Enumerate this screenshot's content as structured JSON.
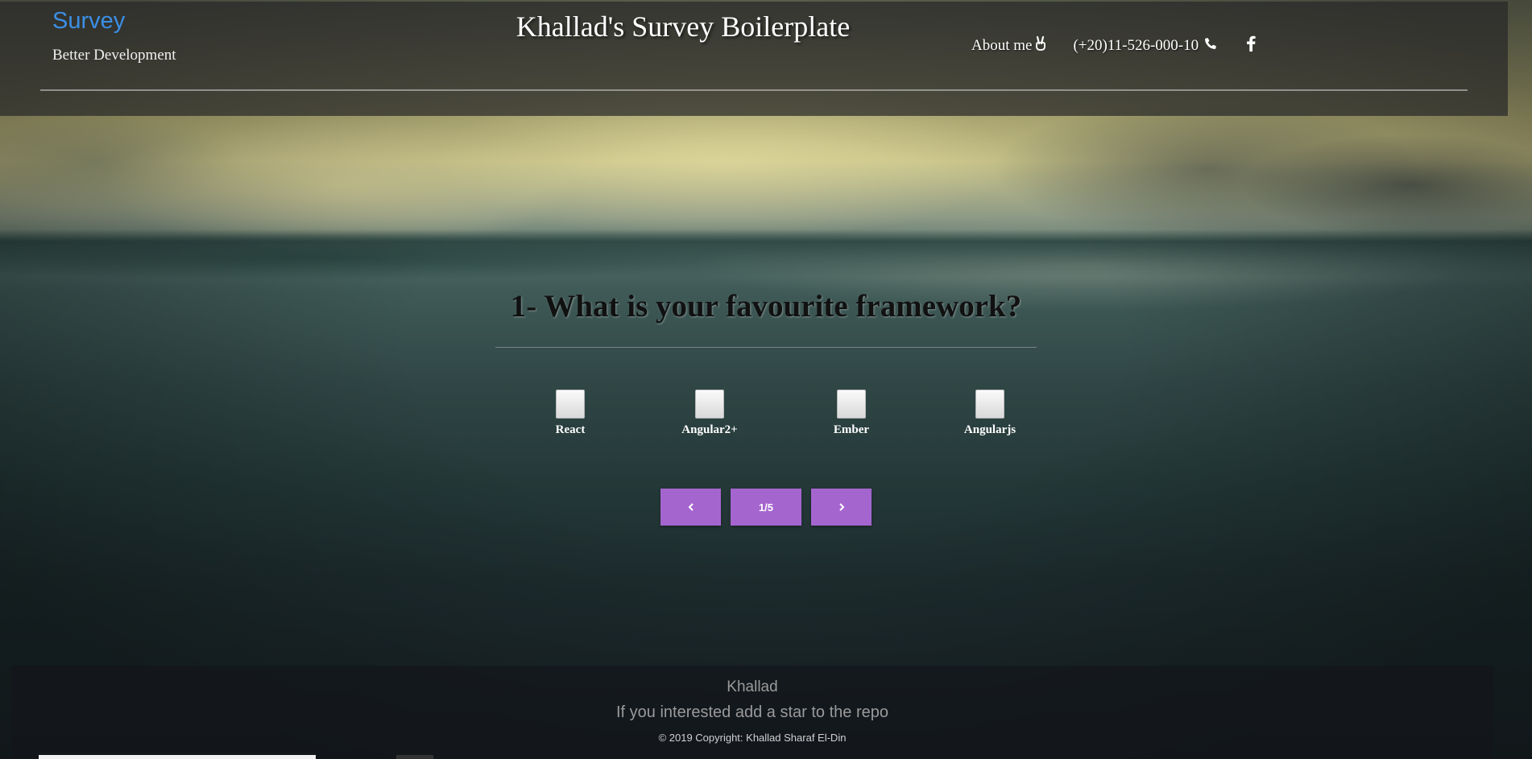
{
  "header": {
    "brand": "Survey",
    "tagline": "Better Development",
    "title": "Khallad's Survey Boilerplate",
    "nav": {
      "about_label": "About me",
      "about_icon": "victory-hand-icon",
      "phone_label": "(+20)11-526-000-10",
      "phone_icon": "phone-icon",
      "facebook_icon": "facebook-icon"
    }
  },
  "question": {
    "text": "1- What is your favourite framework?",
    "options": [
      {
        "label": "React",
        "checked": false
      },
      {
        "label": "Angular2+",
        "checked": false
      },
      {
        "label": "Ember",
        "checked": false
      },
      {
        "label": "Angularjs",
        "checked": false
      }
    ]
  },
  "pagination": {
    "prev_icon": "chevron-left-icon",
    "page_label": "1/5",
    "next_icon": "chevron-right-icon"
  },
  "footer": {
    "name": "Khallad",
    "note": "If you interested add a star to the repo",
    "copyright": "© 2019 Copyright: Khallad Sharaf El-Din"
  },
  "colors": {
    "brand": "#3b8fe6",
    "button": "#a565cf"
  }
}
